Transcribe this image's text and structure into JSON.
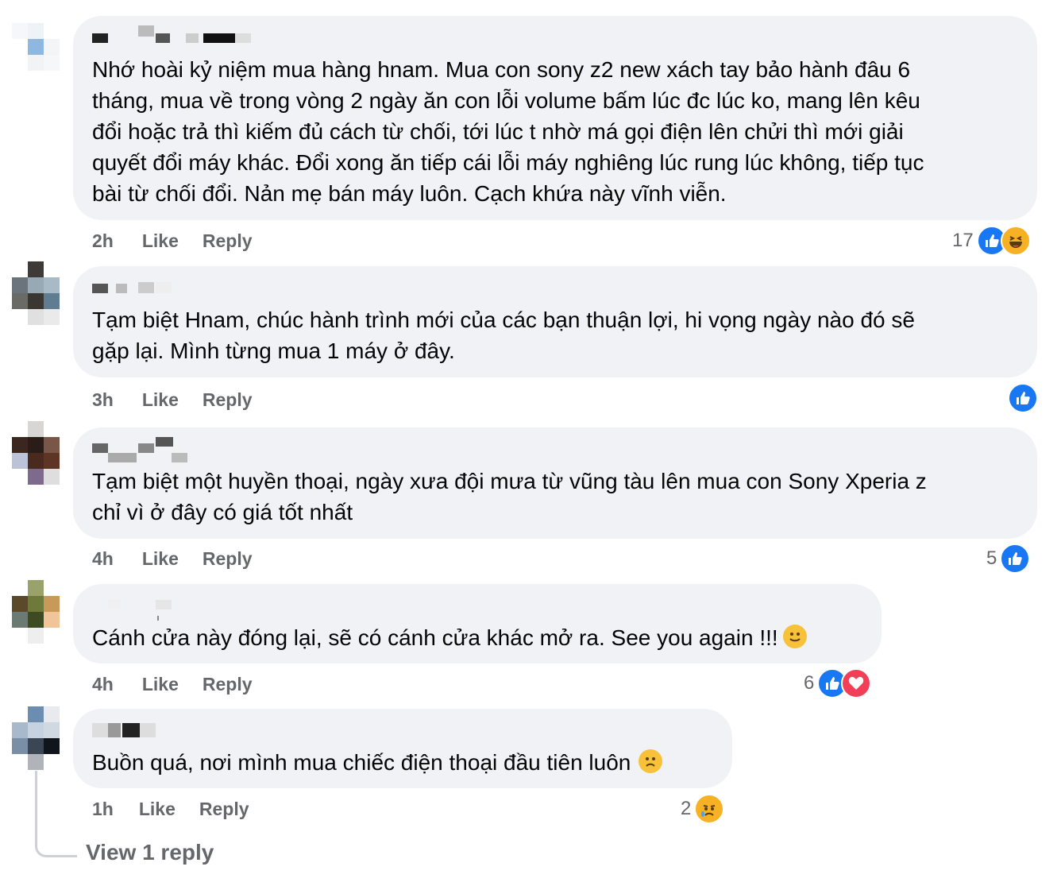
{
  "comments": [
    {
      "text": "Nhớ hoài kỷ niệm mua hàng hnam. Mua con sony z2 new xách tay bảo hành đâu 6\ntháng, mua về trong vòng 2 ngày ăn con lỗi volume bấm lúc đc lúc ko, mang lên kêu\nđổi hoặc trả thì kiếm đủ cách từ chối, tới lúc t nhờ má gọi điện lên chửi thì mới giải\nquyết đổi máy khác. Đổi xong ăn tiếp cái lỗi máy nghiêng lúc rung lúc không, tiếp tục\nbài từ chối đổi. Nản mẹ bán máy luôn. Cạch khứa này vĩnh viễn.",
      "time": "2h",
      "like": "Like",
      "reply": "Reply",
      "reaction_count": "17",
      "reactions": [
        "like-icon",
        "haha-icon"
      ]
    },
    {
      "text": "Tạm biệt Hnam, chúc hành trình mới của các bạn thuận lợi, hi vọng ngày nào đó sẽ\ngặp lại. Mình từng mua 1 máy ở đây.",
      "time": "3h",
      "like": "Like",
      "reply": "Reply",
      "reaction_count": "",
      "reactions": [
        "like-icon"
      ]
    },
    {
      "text": "Tạm biệt một huyền thoại, ngày xưa đội mưa từ vũng tàu lên mua con Sony Xperia z\nchỉ vì ở đây có giá tốt nhất",
      "time": "4h",
      "like": "Like",
      "reply": "Reply",
      "reaction_count": "5",
      "reactions": [
        "like-icon"
      ]
    },
    {
      "text": "Cánh cửa này đóng lại, sẽ có cánh cửa khác mở ra. See you again !!!",
      "emoji": "slightly-smiling-face-icon",
      "time": "4h",
      "like": "Like",
      "reply": "Reply",
      "reaction_count": "6",
      "reactions": [
        "like-icon",
        "love-icon"
      ]
    },
    {
      "text": "Buồn quá, nơi mình mua chiếc điện thoại đầu tiên luôn",
      "emoji": "frowning-face-icon",
      "time": "1h",
      "like": "Like",
      "reply": "Reply",
      "reaction_count": "2",
      "reactions": [
        "sad-icon"
      ]
    }
  ],
  "view_replies": "View 1 reply",
  "colors": {
    "like": "#1877f2",
    "love": "#f33e58",
    "emoji": "#f7b125",
    "bubble": "#f0f2f5",
    "meta": "#65676b"
  }
}
